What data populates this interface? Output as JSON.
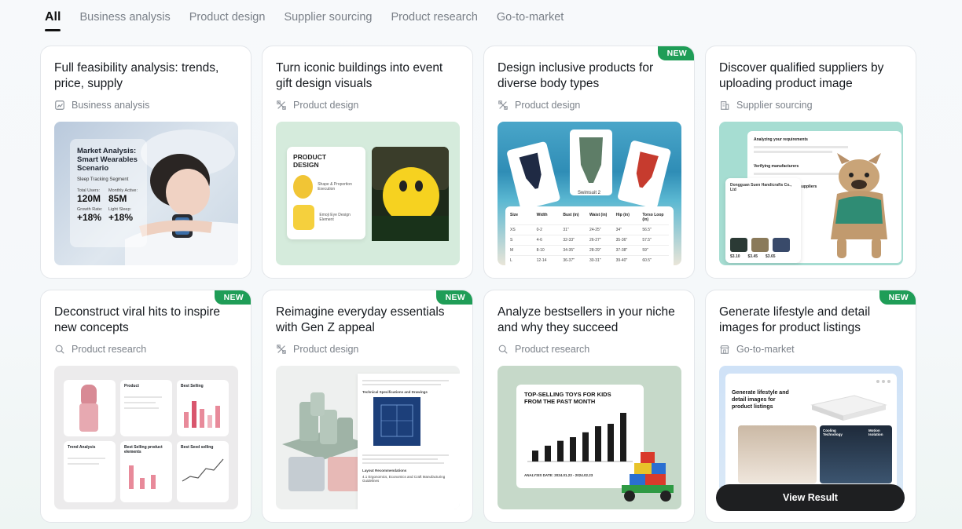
{
  "tabs": [
    {
      "label": "All",
      "active": true
    },
    {
      "label": "Business analysis"
    },
    {
      "label": "Product design"
    },
    {
      "label": "Supplier sourcing"
    },
    {
      "label": "Product research"
    },
    {
      "label": "Go-to-market"
    }
  ],
  "cards": [
    {
      "title": "Full feasibility analysis: trends, price, supply",
      "tag": "Business analysis",
      "tag_icon": "chart-report-icon",
      "thumb": {
        "heading": "Market Analysis: Smart Wearables Scenario",
        "sub": "Sleep Tracking Segment",
        "stats": [
          {
            "label": "Total Users:",
            "value": "120M"
          },
          {
            "label": "Monthly Active:",
            "value": "85M"
          },
          {
            "label": "Growth Rate:",
            "value": "+18%"
          },
          {
            "label": "Light Sleep:",
            "value": "+18%"
          }
        ]
      }
    },
    {
      "title": "Turn iconic buildings into event gift design visuals",
      "tag": "Product design",
      "tag_icon": "design-tools-icon",
      "thumb": {
        "heading": "PRODUCT DESIGN",
        "item1": "Shape & Proportion Execution",
        "item2": "Emoji Eye Design Element"
      }
    },
    {
      "title": "Design inclusive products for diverse body types",
      "tag": "Product design",
      "tag_icon": "design-tools-icon",
      "badge": "NEW",
      "thumb": {
        "caption": "Swimsuit 2",
        "table_headers": [
          "Size",
          "Width",
          "Bust (in)",
          "Waist (in)",
          "Hip (in)",
          "Torso Loop (in)"
        ],
        "table_rows": [
          [
            "XS",
            "0-2",
            "31\"",
            "24-25\"",
            "34\"",
            "56.5\""
          ],
          [
            "S",
            "4-6",
            "32-33\"",
            "26-27\"",
            "35-36\"",
            "57.5\""
          ],
          [
            "M",
            "8-10",
            "34-35\"",
            "28-29\"",
            "37-38\"",
            "59\""
          ],
          [
            "L",
            "12-14",
            "36-37\"",
            "30-31\"",
            "39-40\"",
            "60.5\""
          ]
        ]
      }
    },
    {
      "title": "Discover qualified suppliers by uploading product image",
      "tag": "Supplier sourcing",
      "tag_icon": "building-icon",
      "thumb": {
        "line1": "Analyzing your requirements",
        "line2": "Verifying manufacturers",
        "line3": "Validating products and suppliers",
        "supplier": "Dongguan Suen Handicrafts Co., Ltd",
        "prices": [
          "$3.10",
          "$3.45",
          "$3.65"
        ]
      }
    },
    {
      "title": "Deconstruct viral hits to inspire new concepts",
      "tag": "Product research",
      "tag_icon": "search-sparkle-icon",
      "badge": "NEW",
      "thumb": {
        "panel1": "Product",
        "panel2": "Best Selling",
        "panel3": "Trend Analysis",
        "panel4": "Best Selling product elements",
        "panel5": "Best Seed selling"
      }
    },
    {
      "title": "Reimagine everyday essentials with Gen Z appeal",
      "tag": "Product design",
      "tag_icon": "design-tools-icon",
      "badge": "NEW",
      "thumb": {
        "doc_title": "Technical Specifications and Drawings",
        "doc_section": "Layout Recommendations",
        "doc_sub": "4.1 Ergonomics, Economics and Craft Manufacturing Guidelines"
      }
    },
    {
      "title": "Analyze bestsellers in your niche and why they succeed",
      "tag": "Product research",
      "tag_icon": "search-sparkle-icon",
      "thumb": {
        "heading": "TOP-SELLING TOYS FOR KIDS FROM THE PAST MONTH",
        "footer": "ANALYSIS DATE: 2024.01.23 - 2024.02.23",
        "bars": [
          18,
          26,
          34,
          40,
          48,
          58,
          62,
          80
        ]
      }
    },
    {
      "title": "Generate lifestyle and detail images for product listings",
      "tag": "Go-to-market",
      "tag_icon": "store-icon",
      "badge": "NEW",
      "button": "View Result",
      "thumb": {
        "heading": "Generate lifestyle and detail images for product listings",
        "label1": "Cooling Technology",
        "label2": "Motion Isolation"
      }
    }
  ]
}
